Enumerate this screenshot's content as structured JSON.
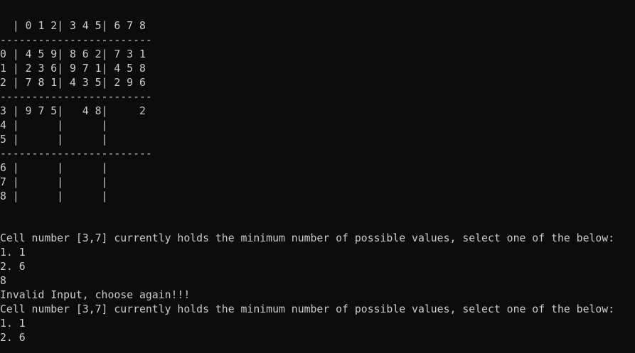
{
  "console": {
    "header": "  | 0 1 2| 3 4 5| 6 7 8",
    "separator": "------------------------",
    "rows": [
      "0 | 4 5 9| 8 6 2| 7 3 1",
      "1 | 2 3 6| 9 7 1| 4 5 8",
      "2 | 7 8 1| 4 3 5| 2 9 6",
      "3 | 9 7 5|   4 8|     2",
      "4 |      |      |",
      "5 |      |      |",
      "6 |      |      |",
      "7 |      |      |",
      "8 |      |      |"
    ],
    "prompt": "Cell number [3,7] currently holds the minimum number of possible values, select one of the below:",
    "options": [
      "1. 1",
      "2. 6"
    ],
    "user_input": "8",
    "error": "Invalid Input, choose again!!!"
  }
}
